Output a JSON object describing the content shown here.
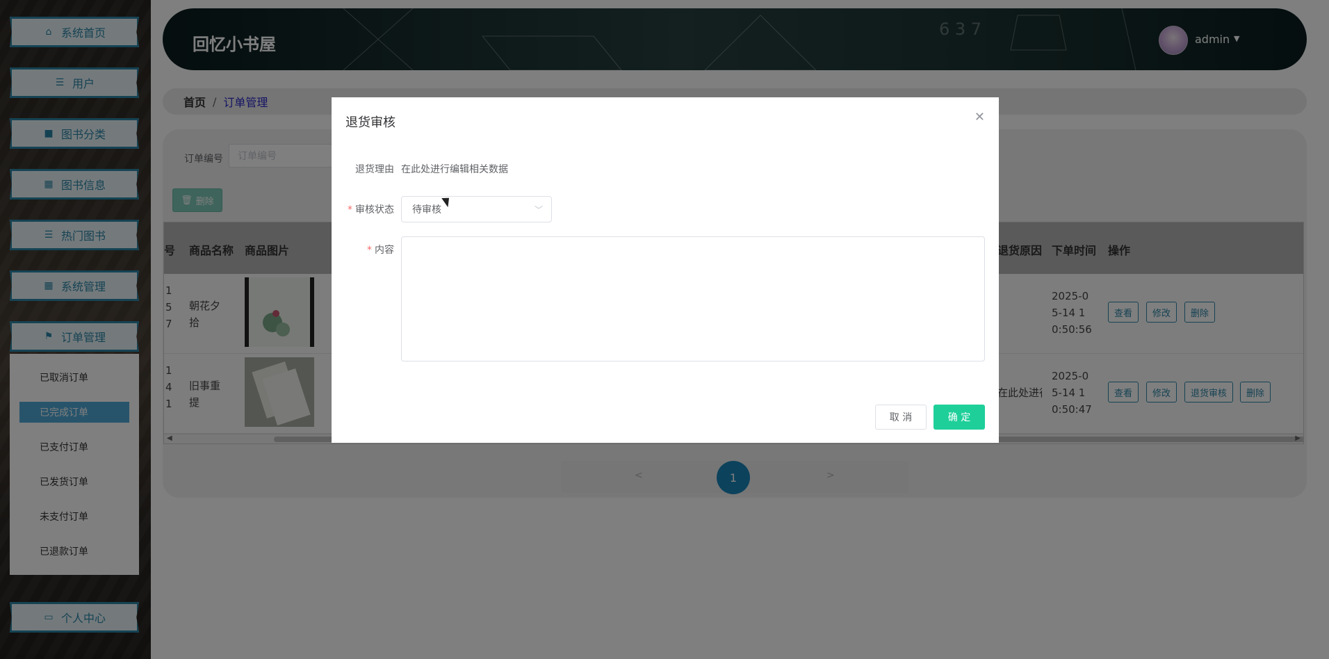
{
  "sidebar": {
    "items": [
      {
        "label": "系统首页",
        "icon": "home-icon"
      },
      {
        "label": "用户",
        "icon": "menu-icon"
      },
      {
        "label": "图书分类",
        "icon": "chat-icon"
      },
      {
        "label": "图书信息",
        "icon": "grid-icon"
      },
      {
        "label": "热门图书",
        "icon": "menu-icon"
      },
      {
        "label": "系统管理",
        "icon": "grid-icon"
      },
      {
        "label": "订单管理",
        "icon": "flag-icon"
      },
      {
        "label": "个人中心",
        "icon": "calendar-icon"
      }
    ],
    "submenu": [
      "已取消订单",
      "已完成订单",
      "已支付订单",
      "已发货订单",
      "未支付订单",
      "已退款订单"
    ]
  },
  "header": {
    "title": "回忆小书屋",
    "user": "admin",
    "chalk_text": "6 3 7"
  },
  "breadcrumb": {
    "home": "首页",
    "separator": "/",
    "current": "订单管理"
  },
  "search": {
    "label": "订单编号",
    "placeholder": "订单编号"
  },
  "toolbar": {
    "delete_label": "删除"
  },
  "table": {
    "headers": [
      "编号",
      "商品名称",
      "商品图片",
      "退货原因",
      "下单时间",
      "操作"
    ],
    "rows": [
      {
        "id": "1\n5\n7",
        "name": "朝花夕\n拾",
        "reason": "",
        "time": "2025-0\n5-14 1\n0:50:56",
        "actions": [
          "查看",
          "修改",
          "删除"
        ]
      },
      {
        "id": "1\n4\n1",
        "name": "旧事重\n提",
        "reason": "在此处进行",
        "time": "2025-0\n5-14 1\n0:50:47",
        "actions": [
          "查看",
          "修改",
          "退货审核",
          "删除"
        ]
      }
    ]
  },
  "pager": {
    "prev": "<",
    "page": "1",
    "next": ">"
  },
  "dialog": {
    "title": "退货审核",
    "fields": {
      "reason_label": "退货理由",
      "reason_value": "在此处进行编辑相关数据",
      "status_label": "审核状态",
      "status_value": "待审核",
      "content_label": "内容",
      "required_mark": "*"
    },
    "cancel_label": "取 消",
    "ok_label": "确 定"
  },
  "colors": {
    "accent": "#2b85a6",
    "confirm": "#1ecf9a",
    "page_active": "#1985b8"
  }
}
